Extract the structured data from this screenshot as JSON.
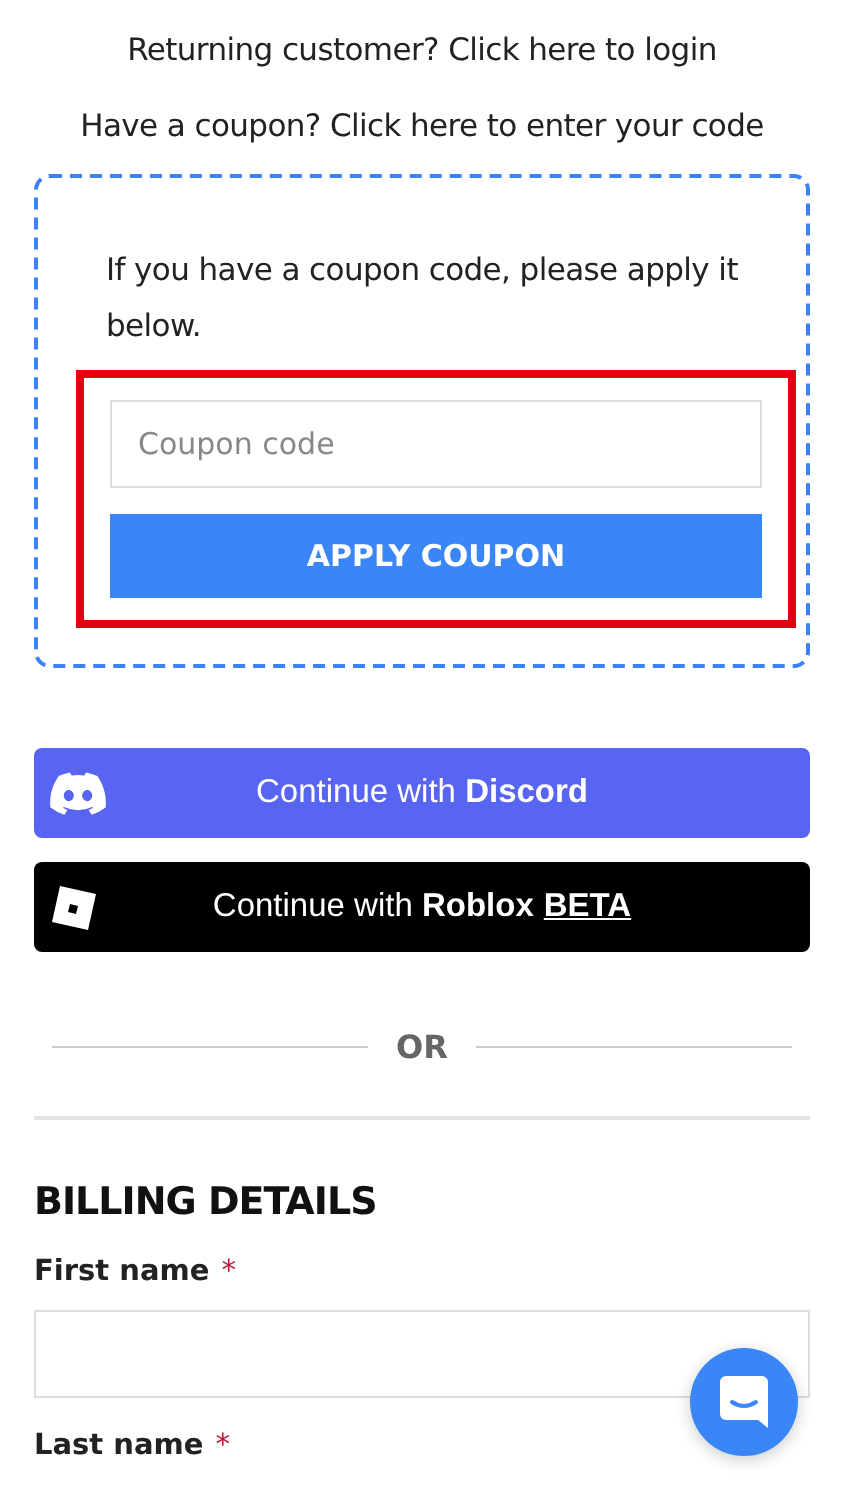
{
  "notices": [
    "Returning customer? Click here to login",
    "Have a coupon? Click here to enter your code"
  ],
  "coupon_form": {
    "intro": "If you have a coupon code, please apply it below.",
    "highlighted": true,
    "field": {
      "placeholder": "Coupon code"
    },
    "button": "APPLY COUPON"
  },
  "login_buttons": [
    {
      "kind": "discord",
      "label": "Continue with **Discord**"
    },
    {
      "kind": "roblox",
      "label": "Continue with **Roblox**",
      "badge": "BETA"
    }
  ],
  "divider": "OR",
  "billing": {
    "heading": "BILLING DETAILS",
    "fields": [
      {
        "label": "First name",
        "required_mark": "*",
        "kind": "input"
      },
      {
        "label": "Last name",
        "required_mark": "*",
        "kind": "label-only"
      }
    ]
  }
}
